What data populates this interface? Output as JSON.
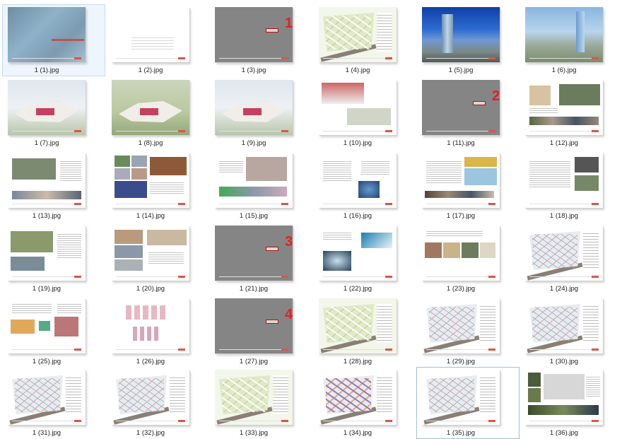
{
  "files": [
    {
      "name": "1 (1).jpg",
      "kind": "cover",
      "selected": true
    },
    {
      "name": "1 (2).jpg",
      "kind": "blank"
    },
    {
      "name": "1 (3).jpg",
      "kind": "divider",
      "section": "1"
    },
    {
      "name": "1 (4).jpg",
      "kind": "plan"
    },
    {
      "name": "1 (5).jpg",
      "kind": "photo-sky"
    },
    {
      "name": "1 (6).jpg",
      "kind": "photo-sky2"
    },
    {
      "name": "1 (7).jpg",
      "kind": "render"
    },
    {
      "name": "1 (8).jpg",
      "kind": "render-green"
    },
    {
      "name": "1 (9).jpg",
      "kind": "render"
    },
    {
      "name": "1 (10).jpg",
      "kind": "page-render"
    },
    {
      "name": "1 (11).jpg",
      "kind": "divider",
      "section": "2"
    },
    {
      "name": "1 (12).jpg",
      "kind": "page-map"
    },
    {
      "name": "1 (13).jpg",
      "kind": "page-aerial"
    },
    {
      "name": "1 (14).jpg",
      "kind": "page-collage"
    },
    {
      "name": "1 (15).jpg",
      "kind": "page-text-photo"
    },
    {
      "name": "1 (16).jpg",
      "kind": "page-diagram"
    },
    {
      "name": "1 (17).jpg",
      "kind": "page-collage2"
    },
    {
      "name": "1 (18).jpg",
      "kind": "page-text"
    },
    {
      "name": "1 (19).jpg",
      "kind": "page-collage3"
    },
    {
      "name": "1 (20).jpg",
      "kind": "page-collage4"
    },
    {
      "name": "1 (21).jpg",
      "kind": "divider",
      "section": "3"
    },
    {
      "name": "1 (22).jpg",
      "kind": "page-art"
    },
    {
      "name": "1 (23).jpg",
      "kind": "page-strip"
    },
    {
      "name": "1 (24).jpg",
      "kind": "plan-white"
    },
    {
      "name": "1 (25).jpg",
      "kind": "page-sketch"
    },
    {
      "name": "1 (26).jpg",
      "kind": "page-section"
    },
    {
      "name": "1 (27).jpg",
      "kind": "divider",
      "section": "4"
    },
    {
      "name": "1 (28).jpg",
      "kind": "plan"
    },
    {
      "name": "1 (29).jpg",
      "kind": "plan-white"
    },
    {
      "name": "1 (30).jpg",
      "kind": "plan-white"
    },
    {
      "name": "1 (31).jpg",
      "kind": "plan-white"
    },
    {
      "name": "1 (32).jpg",
      "kind": "plan-white"
    },
    {
      "name": "1 (33).jpg",
      "kind": "plan"
    },
    {
      "name": "1 (34).jpg",
      "kind": "plan-color"
    },
    {
      "name": "1 (35).jpg",
      "kind": "plan-white",
      "focused": true
    },
    {
      "name": "1 (36).jpg",
      "kind": "page-collage5"
    }
  ]
}
